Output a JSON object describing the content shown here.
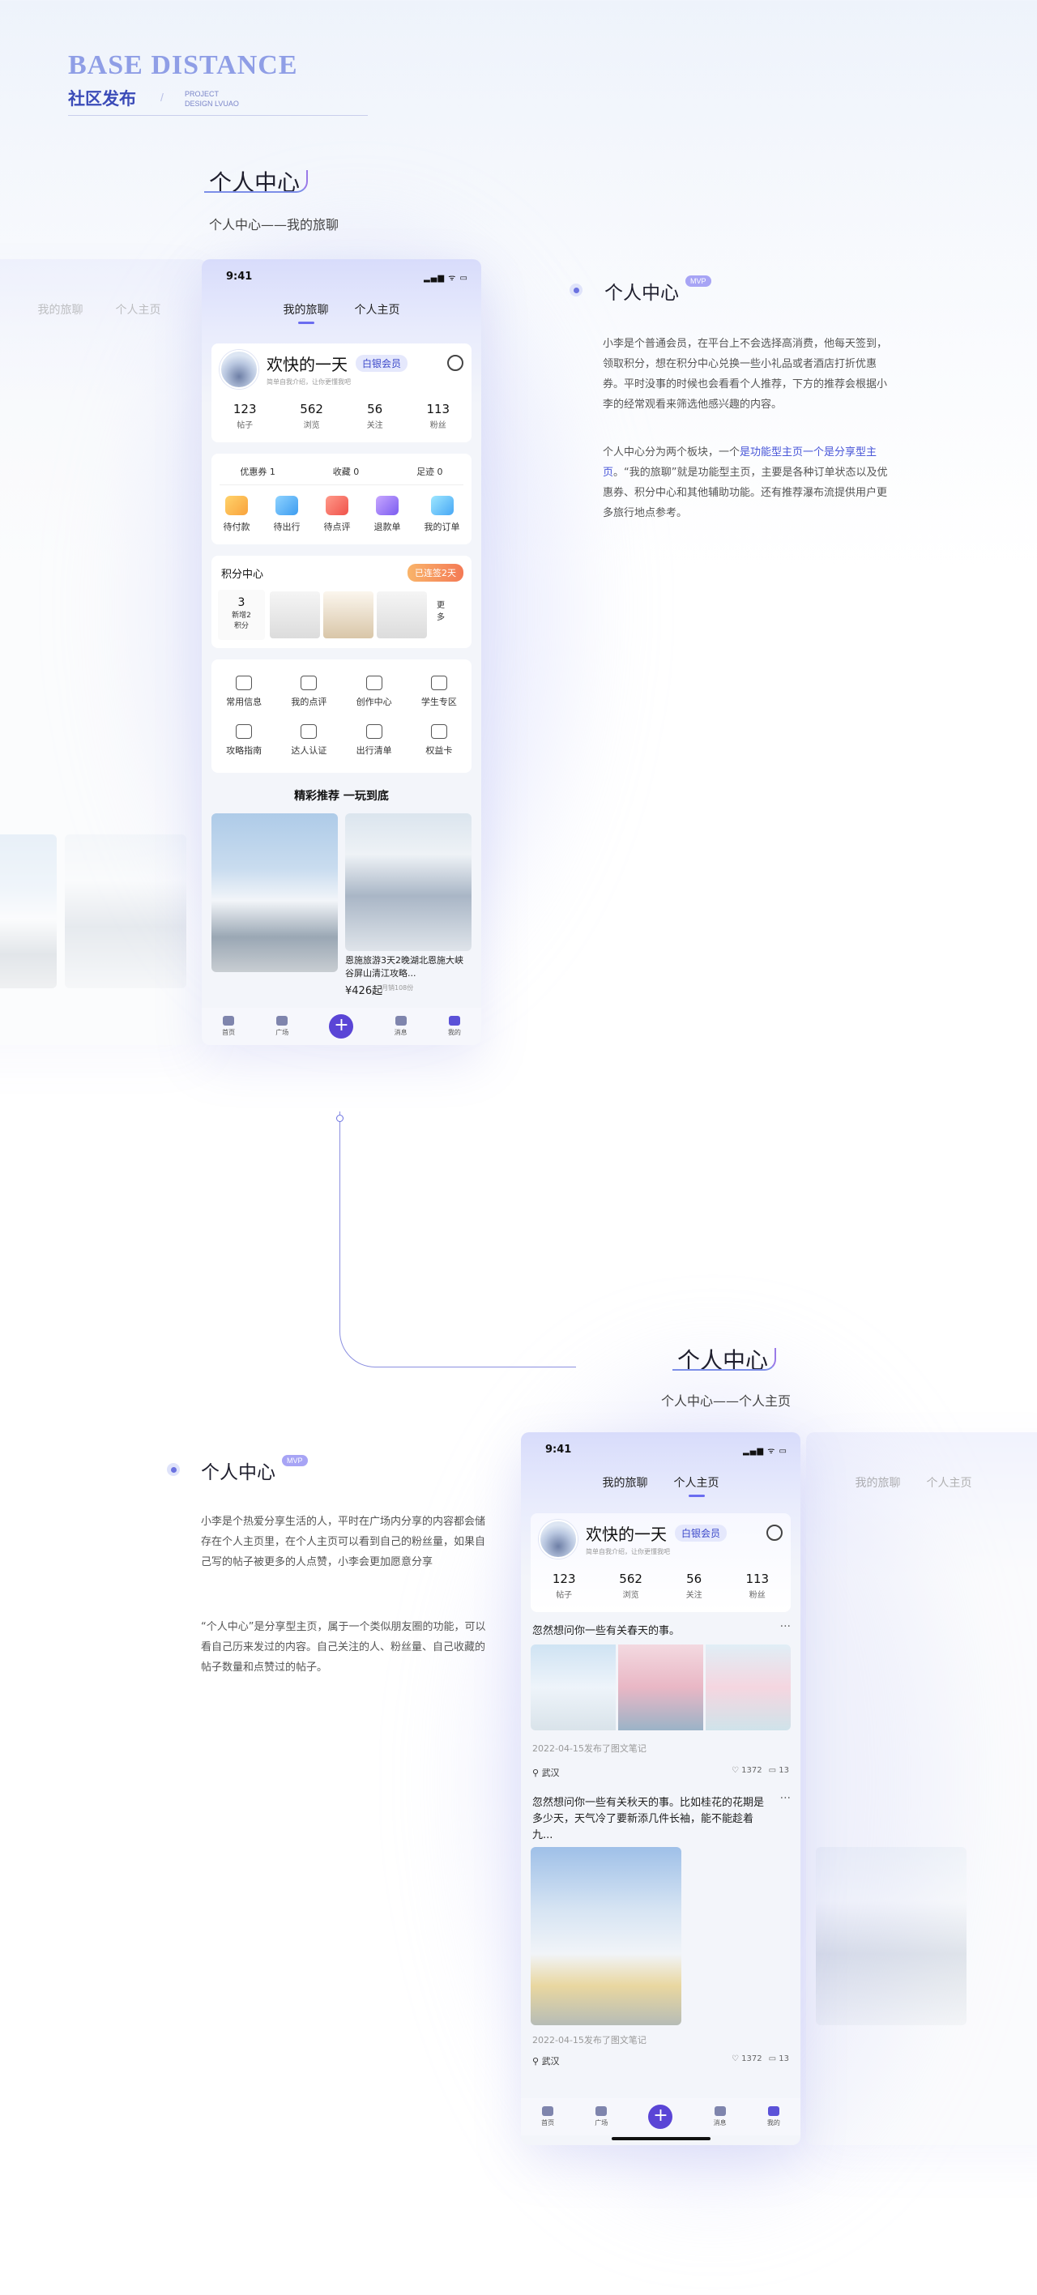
{
  "header": {
    "brand": "BASE DISTANCE",
    "section": "社区发布",
    "slash": "/",
    "project_line1": "PROJECT",
    "project_line2": "DESIGN LVUAO"
  },
  "section1": {
    "title": "个人中心",
    "subtitle": "个人中心——我的旅聊"
  },
  "section2": {
    "title": "个人中心",
    "subtitle": "个人中心——个人主页"
  },
  "desc1": {
    "title": "个人中心",
    "tag": "MVP",
    "p1": "小李是个普通会员，在平台上不会选择高消费，他每天签到，领取积分，想在积分中心兑换一些小礼品或者酒店打折优惠券。平时没事的时候也会看看个人推荐，下方的推荐会根据小李的经常观看来筛选他感兴趣的内容。",
    "p2_a": "个人中心分为两个板块，一个",
    "p2_hl": "是功能型主页一个是分享型主页",
    "p2_b": "。“我的旅聊”就是功能型主页，主要是各种订单状态以及优惠券、积分中心和其他辅助功能。还有推荐瀑布流提供用户更多旅行地点参考。"
  },
  "desc2": {
    "title": "个人中心",
    "tag": "MVP",
    "p1": "小李是个热爱分享生活的人，平时在广场内分享的内容都会储存在个人主页里，在个人主页可以看到自己的粉丝量，如果自己写的帖子被更多的人点赞，小李会更加愿意分享",
    "p2": "“个人中心”是分享型主页，属于一个类似朋友圈的功能，可以看自己历来发过的内容。自己关注的人、粉丝量、自己收藏的帖子数量和点赞过的帖子。"
  },
  "phone": {
    "time": "9:41",
    "tabs": [
      "我的旅聊",
      "个人主页"
    ],
    "user": {
      "name": "欢快的一天",
      "badge": "白银会员",
      "intro": "简单自我介绍，让你更懂我吧"
    },
    "stats": [
      {
        "n": "123",
        "l": "帖子"
      },
      {
        "n": "562",
        "l": "浏览"
      },
      {
        "n": "56",
        "l": "关注"
      },
      {
        "n": "113",
        "l": "粉丝"
      }
    ],
    "coupons": [
      "优惠券 1",
      "收藏 0",
      "足迹 0"
    ],
    "orders": [
      "待付款",
      "待出行",
      "待点评",
      "退款单",
      "我的订单"
    ],
    "points": {
      "title": "积分中心",
      "pill": "已连签2天",
      "count": "3",
      "label1": "新增2",
      "label2": "积分",
      "more1": "更",
      "more2": "多"
    },
    "tools": [
      "常用信息",
      "我的点评",
      "创作中心",
      "学生专区",
      "攻略指南",
      "达人认证",
      "出行清单",
      "权益卡"
    ],
    "rec_title": "精彩推荐  一玩到底",
    "rec_card": {
      "title": "恩施旅游3天2晚湖北恩施大峡谷屏山清江攻略...",
      "price": "¥426起",
      "sold": "月销108份"
    },
    "tabbar": [
      "首页",
      "广场",
      "",
      "消息",
      "我的"
    ],
    "plus": "+"
  },
  "phone2": {
    "post1": {
      "text": "忽然想问你一些有关春天的事。",
      "meta": "2022-04-15发布了图文笔记",
      "loc": "武汉",
      "likes": "1372",
      "comments": "13"
    },
    "post2": {
      "text": "忽然想问你一些有关秋天的事。比如桂花的花期是多少天，天气冷了要新添几件长袖，能不能趁着九...",
      "meta": "2022-04-15发布了图文笔记",
      "loc": "武汉",
      "likes": "1372",
      "comments": "13"
    }
  },
  "icons": {
    "dots": "···",
    "signal": "▂▄▆ ᯤ ▭",
    "heart": "♡",
    "comment": "▭",
    "pin": "⚲"
  }
}
